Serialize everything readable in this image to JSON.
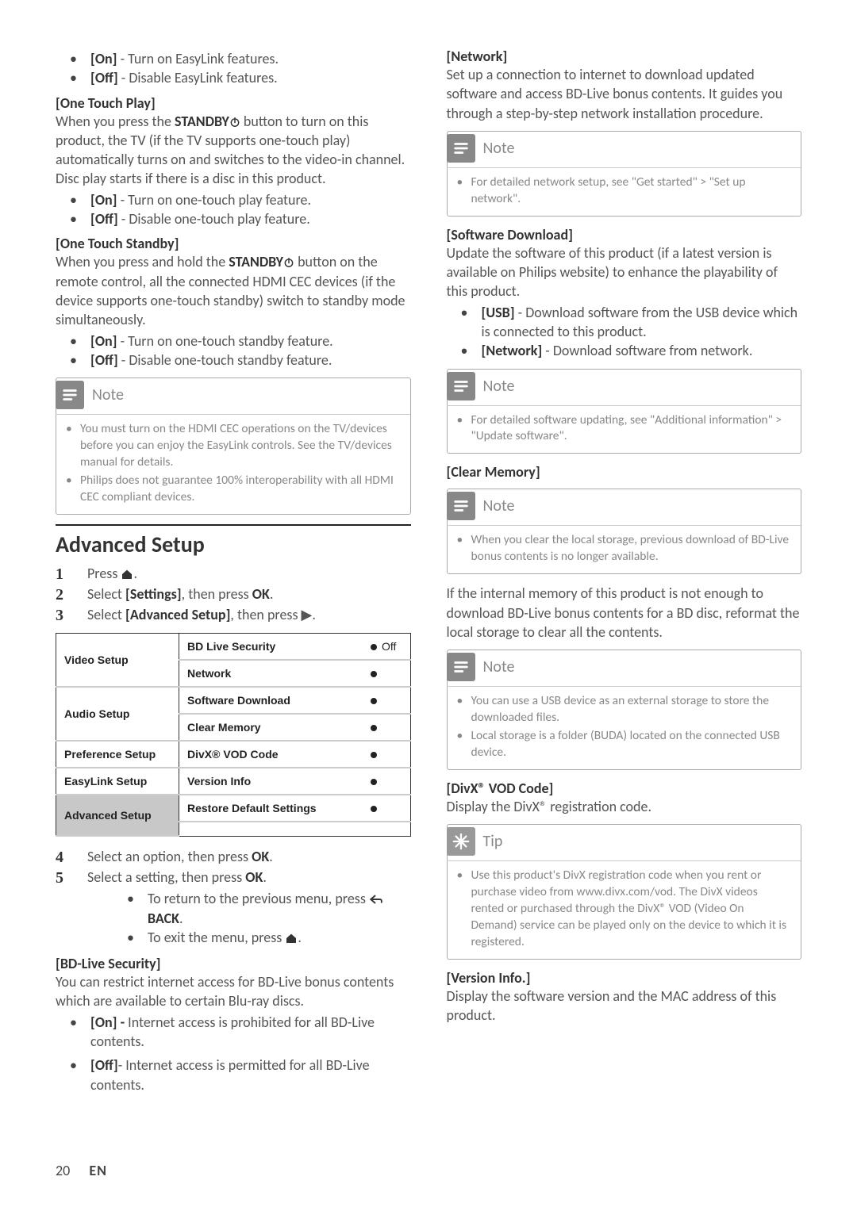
{
  "col1": {
    "easylink_opts": {
      "on": "[On] - Turn on EasyLink features.",
      "off": "[Off] - Disable EasyLink features."
    },
    "otp_head": "[One Touch Play]",
    "otp_body": "When you press the STANDBY⏻ button to turn on this product, the TV (if the TV supports one-touch play) automatically turns on and switches to the video-in channel. Disc play starts if there is a disc in this product.",
    "otp_opts": {
      "on": "[On] - Turn on one-touch play feature.",
      "off": "[Off] - Disable one-touch play feature."
    },
    "ots_head": "[One Touch Standby]",
    "ots_body": "When you press and hold the STANDBY⏻ button on the remote control, all the connected HDMI CEC devices (if the device supports one-touch standby) switch to standby mode simultaneously.",
    "ots_opts": {
      "on": "[On] - Turn on one-touch standby feature.",
      "off": "[Off] - Disable one-touch standby feature."
    },
    "note1": {
      "title": "Note",
      "items": [
        "You must turn on the HDMI CEC operations on the TV/devices before you can enjoy the EasyLink controls. See the TV/devices manual for details.",
        "Philips does not guarantee 100% interoperability with all HDMI CEC compliant devices."
      ]
    },
    "section_title": "Advanced Setup",
    "steps_top": [
      "Press ⌂.",
      "Select [Settings], then press OK.",
      "Select [Advanced Setup], then press ▶."
    ],
    "table": {
      "left": [
        "Video Setup",
        "Audio Setup",
        "Preference Setup",
        "EasyLink Setup",
        "Advanced Setup"
      ],
      "rows": [
        {
          "label": "BD Live Security",
          "val": "Off"
        },
        {
          "label": "Network",
          "val": ""
        },
        {
          "label": "Software Download",
          "val": ""
        },
        {
          "label": "Clear Memory",
          "val": ""
        },
        {
          "label": "DivX® VOD Code",
          "val": ""
        },
        {
          "label": "Version Info",
          "val": ""
        },
        {
          "label": "Restore Default Settings",
          "val": ""
        }
      ]
    },
    "steps_bottom": {
      "s4": "Select an option, then press OK.",
      "s5": "Select a setting, then press OK.",
      "s5a": "To return to the previous menu, press ↶ BACK.",
      "s5b": "To exit the menu, press ⌂."
    },
    "bdlive_head": "[BD-Live Security]",
    "bdlive_body": "You can restrict internet access for BD-Live bonus contents which are available to certain Blu-ray discs.",
    "bdlive_on": "[On] - Internet access is prohibited for all BD-Live contents."
  },
  "col2": {
    "bdlive_off": "[Off]- Internet access is permitted for all BD-Live contents.",
    "net_head": "[Network]",
    "net_body": "Set up a connection to internet to download updated software and access BD-Live bonus contents. It guides you through a step-by-step network installation procedure.",
    "note_net": {
      "title": "Note",
      "items": [
        "For detailed network setup, see \"Get started\" > \"Set up network\"."
      ]
    },
    "sw_head": "[Software Download]",
    "sw_body": "Update the software of this product (if a latest version is available on Philips website) to enhance the playability of this product.",
    "sw_opts": {
      "usb": "[USB] - Download software from the USB device which is connected to this product.",
      "net": "[Network] - Download software from network."
    },
    "note_sw": {
      "title": "Note",
      "items": [
        "For detailed software updating, see \"Additional information\" > \"Update software\"."
      ]
    },
    "clear_head": "[Clear Memory]",
    "note_clear": {
      "title": "Note",
      "items": [
        "When you clear the local storage, previous download of BD-Live bonus contents is no longer available."
      ]
    },
    "clear_body": "If the internal memory of this product is not enough to download BD-Live bonus contents for a BD disc, reformat the local storage to clear all the contents.",
    "note_usb": {
      "title": "Note",
      "items": [
        "You can use a USB device as an external storage to store the downloaded files.",
        "Local storage is a folder (BUDA) located on the connected USB device."
      ]
    },
    "divx_head": "[DivX® VOD Code]",
    "divx_body": "Display the DivX® registration code.",
    "tip": {
      "title": "Tip",
      "items": [
        "Use this product's DivX registration code when you rent or purchase video from www.divx.com/vod. The DivX videos rented or purchased through the DivX® VOD (Video On Demand) service can be played only on the device to which it is registered."
      ]
    },
    "ver_head": "[Version Info.]",
    "ver_body": "Display the software version and the MAC address of this product."
  },
  "footer": {
    "page": "20",
    "lang": "EN"
  }
}
